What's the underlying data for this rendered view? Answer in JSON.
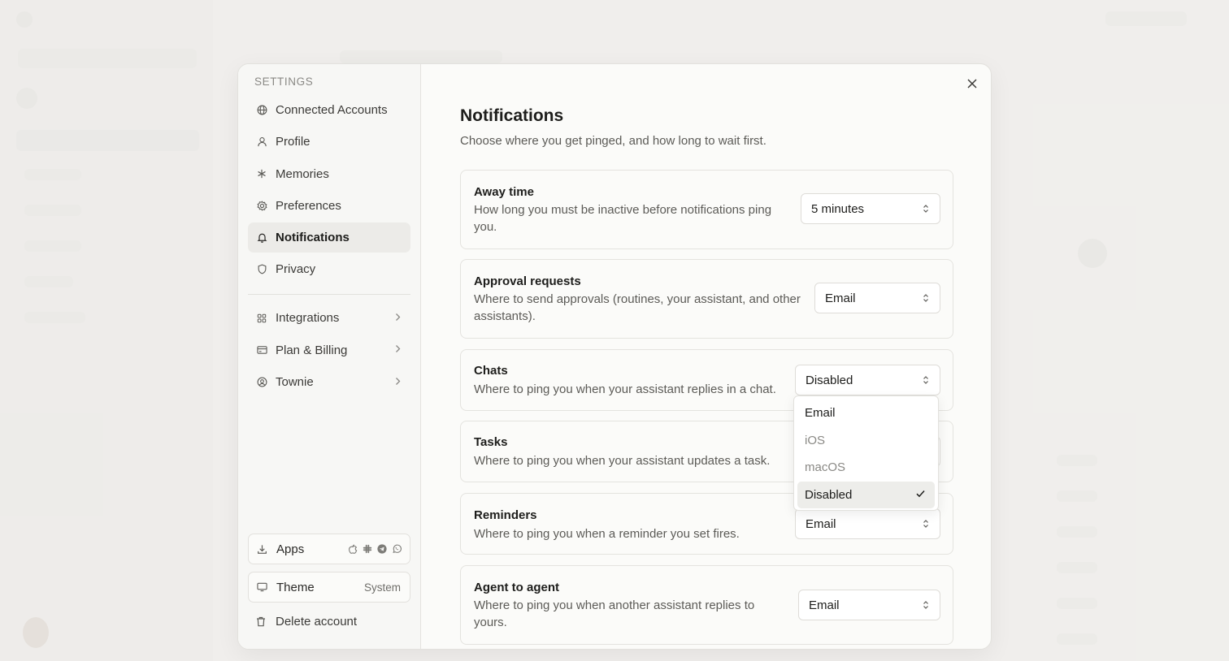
{
  "settings_nav": {
    "heading": "SETTINGS",
    "items": [
      {
        "label": "Connected Accounts",
        "icon": "globe-icon"
      },
      {
        "label": "Profile",
        "icon": "user-icon"
      },
      {
        "label": "Memories",
        "icon": "asterisk-icon"
      },
      {
        "label": "Preferences",
        "icon": "gear-icon"
      },
      {
        "label": "Notifications",
        "icon": "bell-icon",
        "active": true
      },
      {
        "label": "Privacy",
        "icon": "shield-icon"
      }
    ],
    "expandable_items": [
      {
        "label": "Integrations",
        "icon": "grid-icon"
      },
      {
        "label": "Plan & Billing",
        "icon": "credit-card-icon"
      },
      {
        "label": "Townie",
        "icon": "user-circle-icon"
      }
    ],
    "apps_label": "Apps",
    "apps_icons": [
      "apple-icon",
      "slack-icon",
      "telegram-icon",
      "whatsapp-icon"
    ],
    "theme_label": "Theme",
    "theme_value": "System",
    "delete_label": "Delete account"
  },
  "main": {
    "title": "Notifications",
    "subtitle": "Choose where you get pinged, and how long to wait first.",
    "settings": [
      {
        "title": "Away time",
        "desc": "How long you must be inactive before notifications ping you.",
        "value": "5 minutes"
      },
      {
        "title": "Approval requests",
        "desc": "Where to send approvals (routines, your assistant, and other assistants).",
        "value": "Email"
      },
      {
        "title": "Chats",
        "desc": "Where to ping you when your assistant replies in a chat.",
        "value": "Disabled"
      },
      {
        "title": "Tasks",
        "desc": "Where to ping you when your assistant updates a task.",
        "value": ""
      },
      {
        "title": "Reminders",
        "desc": "Where to ping you when a reminder you set fires.",
        "value": "Email"
      },
      {
        "title": "Agent to agent",
        "desc": "Where to ping you when another assistant replies to yours.",
        "value": "Email"
      }
    ]
  },
  "dropdown": {
    "options": [
      {
        "label": "Email",
        "state": "enabled"
      },
      {
        "label": "iOS",
        "state": "muted"
      },
      {
        "label": "macOS",
        "state": "muted"
      },
      {
        "label": "Disabled",
        "state": "selected"
      }
    ]
  },
  "colors": {
    "active_nav_bg": "#ecebe8",
    "modal_bg": "#fbfbf9",
    "muted_text": "#8a8985"
  }
}
